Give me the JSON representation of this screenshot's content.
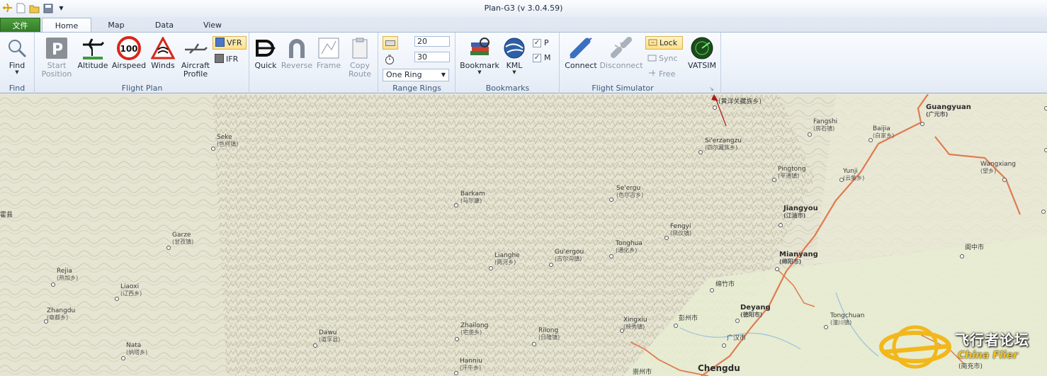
{
  "window": {
    "title": "Plan-G3 (v 3.0.4.59)"
  },
  "tabs": {
    "file": "文件",
    "items": [
      "Home",
      "Map",
      "Data",
      "View"
    ],
    "active": "Home"
  },
  "ribbon": {
    "find": {
      "button": "Find",
      "group": "Find"
    },
    "flight_plan": {
      "group": "Flight Plan",
      "start_position": [
        "Start",
        "Position"
      ],
      "altitude": "Altitude",
      "airspeed": "Airspeed",
      "airspeed_badge": "100",
      "winds": "Winds",
      "aircraft_profile": [
        "Aircraft",
        "Profile"
      ],
      "vfr": "VFR",
      "ifr": "IFR",
      "quick": "Quick",
      "reverse": "Reverse",
      "frame": "Frame",
      "copy_route": [
        "Copy",
        "Route"
      ]
    },
    "range_rings": {
      "group": "Range Rings",
      "value1": "20",
      "value2": "30",
      "mode": "One Ring"
    },
    "bookmarks": {
      "group": "Bookmarks",
      "bookmark": "Bookmark",
      "kml": "KML",
      "p": "P",
      "m": "M",
      "p_checked": true,
      "m_checked": true
    },
    "flight_simulator": {
      "group": "Flight Simulator",
      "connect": "Connect",
      "disconnect": "Disconnect",
      "lock": "Lock",
      "sync": "Sync",
      "free": "Free"
    },
    "vatsim": "VATSIM"
  },
  "map": {
    "places": [
      {
        "name": "Seke",
        "sub": "(色柯镇)"
      },
      {
        "name": "Barkam",
        "sub": "(马尔康)"
      },
      {
        "name": "Se'ergu",
        "sub": "(色尔古乡)"
      },
      {
        "name": "Si'erzangzu",
        "sub": "(四尔藏族乡)"
      },
      {
        "name": "Fangshi",
        "sub": "(房石镇)"
      },
      {
        "name": "Baijia",
        "sub": "(白家乡)"
      },
      {
        "name": "Guangyuan",
        "sub": "(广元市)"
      },
      {
        "name": "Wangxiang",
        "sub": "(望乡)"
      },
      {
        "name": "Pingtong",
        "sub": "(平通镇)"
      },
      {
        "name": "Yunji",
        "sub": "(云集乡)"
      },
      {
        "name": "Jiangyou",
        "sub": "(江油市)"
      },
      {
        "name": "Garze",
        "sub": "(甘孜镇)"
      },
      {
        "name": "Fengyi",
        "sub": "(凤仪镇)"
      },
      {
        "name": "Tonghua",
        "sub": "(通化乡)"
      },
      {
        "name": "Lianghe",
        "sub": "(两河乡)"
      },
      {
        "name": "Gu'ergou",
        "sub": "(古尔沟镇)"
      },
      {
        "name": "Mianyang",
        "sub": "(绵阳市)"
      },
      {
        "name": "阆中市",
        "sub": ""
      },
      {
        "name": "Rejia",
        "sub": "(热加乡)"
      },
      {
        "name": "Liaoxi",
        "sub": "(辽西乡)"
      },
      {
        "name": "绵竹市",
        "sub": ""
      },
      {
        "name": "Zhangdu",
        "sub": "(章都乡)"
      },
      {
        "name": "Deyang",
        "sub": "(德阳市)"
      },
      {
        "name": "Tongchuan",
        "sub": "(潼川镇)"
      },
      {
        "name": "Xingxiu",
        "sub": "(映秀镇)"
      },
      {
        "name": "彭州市",
        "sub": ""
      },
      {
        "name": "Zhailong",
        "sub": "(宅垄乡)"
      },
      {
        "name": "Rilong",
        "sub": "(日隆镇)"
      },
      {
        "name": "Dawu",
        "sub": "(道孚县)"
      },
      {
        "name": "广汉市",
        "sub": ""
      },
      {
        "name": "Nata",
        "sub": "(纳塔乡)"
      },
      {
        "name": "Hanniu",
        "sub": "(汗牛乡)"
      },
      {
        "name": "Chengdu",
        "sub": ""
      },
      {
        "name": "崇州市",
        "sub": ""
      },
      {
        "name": "(南充市)",
        "sub": ""
      },
      {
        "name": "(黄洋关藏族乡)",
        "sub": ""
      },
      {
        "name": "霍县",
        "sub": ""
      }
    ]
  },
  "watermark": {
    "cn": "飞行者论坛",
    "en": "China Flier"
  }
}
